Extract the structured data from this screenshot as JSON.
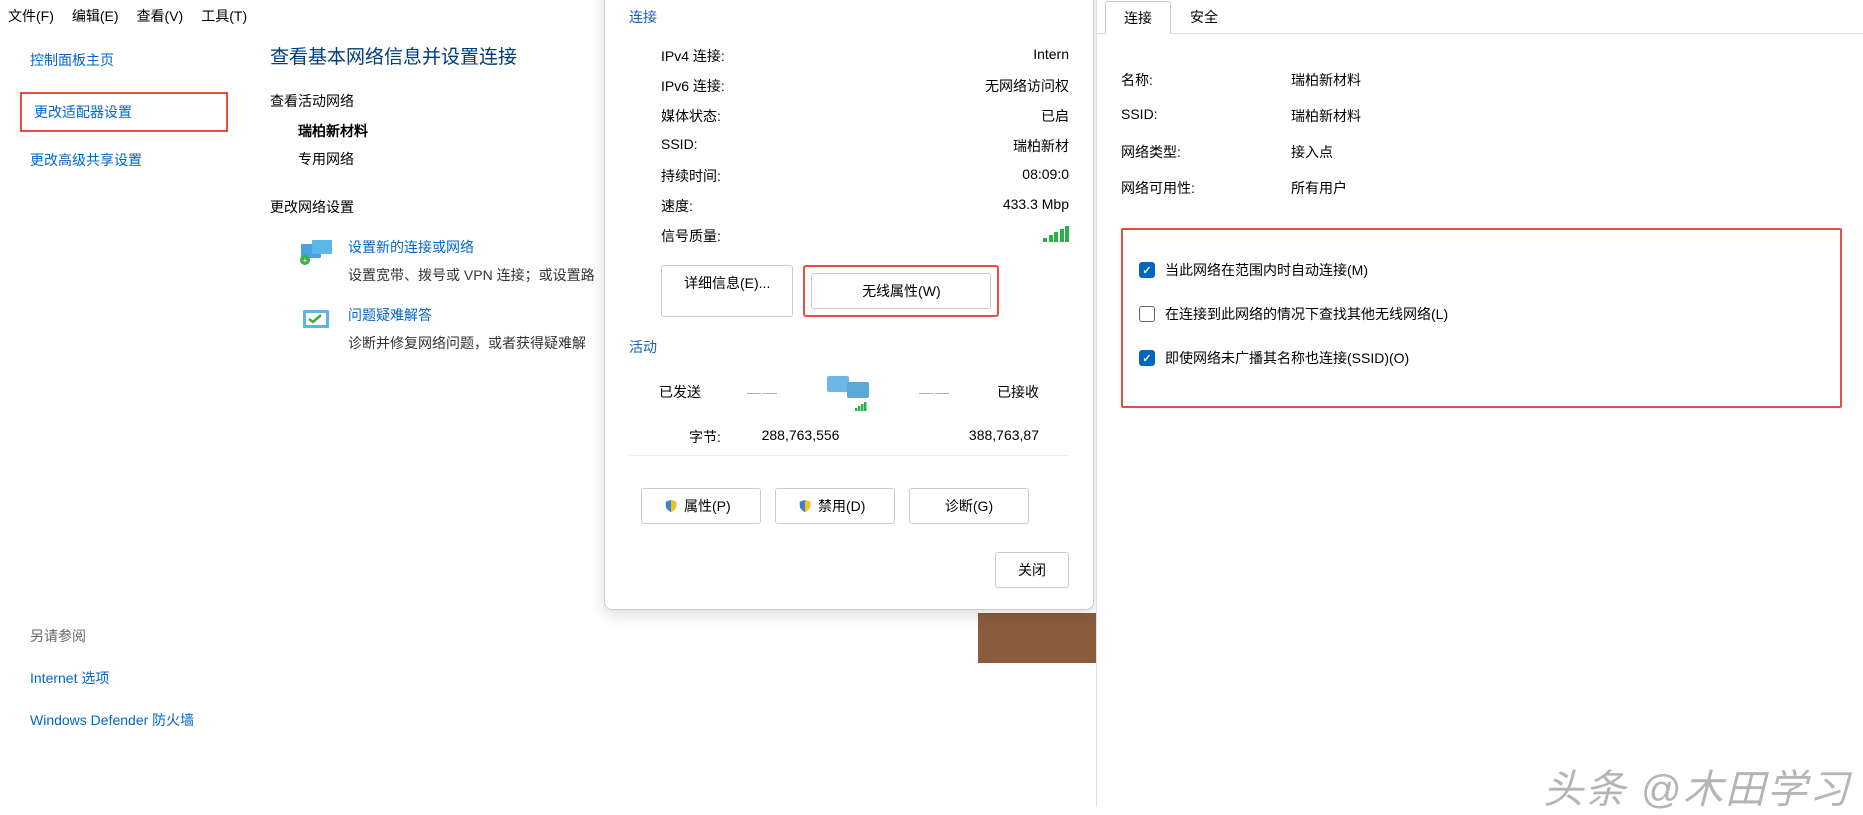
{
  "menubar": {
    "file": "文件(F)",
    "edit": "编辑(E)",
    "view": "查看(V)",
    "tools": "工具(T)"
  },
  "leftPanel": {
    "homeLink": "控制面板主页",
    "adapterSettings": "更改适配器设置",
    "sharingSettings": "更改高级共享设置",
    "seeAlso": "另请参阅",
    "internetOptions": "Internet 选项",
    "defender": "Windows Defender 防火墙"
  },
  "center": {
    "heading": "查看基本网络信息并设置连接",
    "viewActive": "查看活动网络",
    "networkName": "瑞柏新材料",
    "networkType": "专用网络",
    "changeSettings": "更改网络设置",
    "newConn": {
      "title": "设置新的连接或网络",
      "desc": "设置宽带、拨号或 VPN 连接；或设置路"
    },
    "troubleshoot": {
      "title": "问题疑难解答",
      "desc": "诊断并修复网络问题，或者获得疑难解"
    }
  },
  "status": {
    "connHeader": "连接",
    "rows": {
      "ipv4": {
        "label": "IPv4 连接:",
        "value": "Intern"
      },
      "ipv6": {
        "label": "IPv6 连接:",
        "value": "无网络访问权"
      },
      "media": {
        "label": "媒体状态:",
        "value": "已启"
      },
      "ssid": {
        "label": "SSID:",
        "value": "瑞柏新材"
      },
      "duration": {
        "label": "持续时间:",
        "value": "08:09:0"
      },
      "speed": {
        "label": "速度:",
        "value": "433.3 Mbp"
      },
      "signal": {
        "label": "信号质量:"
      }
    },
    "detailsBtn": "详细信息(E)...",
    "wirelessBtn": "无线属性(W)",
    "activity": "活动",
    "sent": "已发送",
    "recv": "已接收",
    "bytesLabel": "字节:",
    "bytesSent": "288,763,556",
    "bytesRecv": "388,763,87",
    "propsBtn": "属性(P)",
    "disableBtn": "禁用(D)",
    "diagBtn": "诊断(G)",
    "closeBtn": "关闭"
  },
  "props": {
    "tabConn": "连接",
    "tabSec": "安全",
    "name": {
      "label": "名称:",
      "value": "瑞柏新材料"
    },
    "ssid": {
      "label": "SSID:",
      "value": "瑞柏新材料"
    },
    "netType": {
      "label": "网络类型:",
      "value": "接入点"
    },
    "avail": {
      "label": "网络可用性:",
      "value": "所有用户"
    },
    "check1": "当此网络在范围内时自动连接(M)",
    "check2": "在连接到此网络的情况下查找其他无线网络(L)",
    "check3": "即使网络未广播其名称也连接(SSID)(O)"
  },
  "watermark": "头条 @木田学习"
}
